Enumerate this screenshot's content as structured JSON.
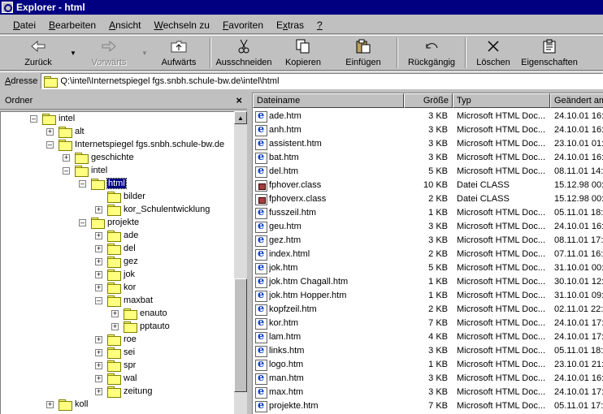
{
  "window": {
    "title": "Explorer - html"
  },
  "menu": [
    {
      "label": "Datei",
      "accel": "D",
      "rest": "atei"
    },
    {
      "label": "Bearbeiten",
      "accel": "B",
      "rest": "earbeiten"
    },
    {
      "label": "Ansicht",
      "accel": "A",
      "rest": "nsicht"
    },
    {
      "label": "Wechseln zu",
      "accel": "W",
      "rest": "echseln zu"
    },
    {
      "label": "Favoriten",
      "accel": "F",
      "rest": "avoriten"
    },
    {
      "label": "Extras",
      "pre": "E",
      "accel": "x",
      "rest": "tras"
    },
    {
      "label": "?",
      "accel": "?",
      "rest": ""
    }
  ],
  "toolbar": {
    "back": "Zurück",
    "forward": "Vorwärts",
    "up": "Aufwärts",
    "cut": "Ausschneiden",
    "copy": "Kopieren",
    "paste": "Einfügen",
    "undo": "Rückgängig",
    "delete": "Löschen",
    "properties": "Eigenschaften"
  },
  "address": {
    "label": "Adresse",
    "value": "Q:\\intel\\Internetspiegel fgs.snbh.schule-bw.de\\intel\\html"
  },
  "folder_pane": {
    "title": "Ordner",
    "close": "×",
    "tree": [
      {
        "label": "intel",
        "level": 0,
        "expander": "-"
      },
      {
        "label": "alt",
        "level": 1,
        "expander": "+"
      },
      {
        "label": "Internetspiegel fgs.snbh.schule-bw.de",
        "level": 1,
        "expander": "-"
      },
      {
        "label": "geschichte",
        "level": 2,
        "expander": "+"
      },
      {
        "label": "intel",
        "level": 2,
        "expander": "-"
      },
      {
        "label": "html",
        "level": 3,
        "expander": "-",
        "selected": true
      },
      {
        "label": "bilder",
        "level": 4,
        "expander": ""
      },
      {
        "label": "kor_Schulentwicklung",
        "level": 4,
        "expander": "+"
      },
      {
        "label": "projekte",
        "level": 3,
        "expander": "-"
      },
      {
        "label": "ade",
        "level": 4,
        "expander": "+"
      },
      {
        "label": "del",
        "level": 4,
        "expander": "+"
      },
      {
        "label": "gez",
        "level": 4,
        "expander": "+"
      },
      {
        "label": "jok",
        "level": 4,
        "expander": "+"
      },
      {
        "label": "kor",
        "level": 4,
        "expander": "+"
      },
      {
        "label": "maxbat",
        "level": 4,
        "expander": "-"
      },
      {
        "label": "enauto",
        "level": 5,
        "expander": "+"
      },
      {
        "label": "pptauto",
        "level": 5,
        "expander": "+"
      },
      {
        "label": "roe",
        "level": 4,
        "expander": "+"
      },
      {
        "label": "sei",
        "level": 4,
        "expander": "+"
      },
      {
        "label": "spr",
        "level": 4,
        "expander": "+"
      },
      {
        "label": "wal",
        "level": 4,
        "expander": "+"
      },
      {
        "label": "zeitung",
        "level": 4,
        "expander": "+"
      },
      {
        "label": "koll",
        "level": 1,
        "expander": "+"
      }
    ]
  },
  "file_list": {
    "columns": [
      "Dateiname",
      "Größe",
      "Typ",
      "Geändert am"
    ],
    "files": [
      {
        "name": "ade.htm",
        "size": "3 KB",
        "type": "Microsoft HTML Doc...",
        "date": "24.10.01 16:",
        "icon": "html"
      },
      {
        "name": "anh.htm",
        "size": "3 KB",
        "type": "Microsoft HTML Doc...",
        "date": "24.10.01 16:",
        "icon": "html"
      },
      {
        "name": "assistent.htm",
        "size": "3 KB",
        "type": "Microsoft HTML Doc...",
        "date": "23.10.01 01:",
        "icon": "html"
      },
      {
        "name": "bat.htm",
        "size": "3 KB",
        "type": "Microsoft HTML Doc...",
        "date": "24.10.01 16:",
        "icon": "html"
      },
      {
        "name": "del.htm",
        "size": "5 KB",
        "type": "Microsoft HTML Doc...",
        "date": "08.11.01 14:",
        "icon": "html"
      },
      {
        "name": "fphover.class",
        "size": "10 KB",
        "type": "Datei CLASS",
        "date": "15.12.98 00:",
        "icon": "class"
      },
      {
        "name": "fphoverx.class",
        "size": "2 KB",
        "type": "Datei CLASS",
        "date": "15.12.98 00:",
        "icon": "class"
      },
      {
        "name": "fusszeil.htm",
        "size": "1 KB",
        "type": "Microsoft HTML Doc...",
        "date": "05.11.01 18:",
        "icon": "html"
      },
      {
        "name": "geu.htm",
        "size": "3 KB",
        "type": "Microsoft HTML Doc...",
        "date": "24.10.01 16:",
        "icon": "html"
      },
      {
        "name": "gez.htm",
        "size": "3 KB",
        "type": "Microsoft HTML Doc...",
        "date": "08.11.01 17:",
        "icon": "html"
      },
      {
        "name": "index.html",
        "size": "2 KB",
        "type": "Microsoft HTML Doc...",
        "date": "07.11.01 16:",
        "icon": "html"
      },
      {
        "name": "jok.htm",
        "size": "5 KB",
        "type": "Microsoft HTML Doc...",
        "date": "31.10.01 00:",
        "icon": "html"
      },
      {
        "name": "jok.htm Chagall.htm",
        "size": "1 KB",
        "type": "Microsoft HTML Doc...",
        "date": "30.10.01 12:",
        "icon": "html"
      },
      {
        "name": "jok.htm Hopper.htm",
        "size": "1 KB",
        "type": "Microsoft HTML Doc...",
        "date": "31.10.01 09:",
        "icon": "html"
      },
      {
        "name": "kopfzeil.htm",
        "size": "2 KB",
        "type": "Microsoft HTML Doc...",
        "date": "02.11.01 22:",
        "icon": "html"
      },
      {
        "name": "kor.htm",
        "size": "7 KB",
        "type": "Microsoft HTML Doc...",
        "date": "24.10.01 17:",
        "icon": "html"
      },
      {
        "name": "lam.htm",
        "size": "4 KB",
        "type": "Microsoft HTML Doc...",
        "date": "24.10.01 17:",
        "icon": "html"
      },
      {
        "name": "links.htm",
        "size": "3 KB",
        "type": "Microsoft HTML Doc...",
        "date": "05.11.01 18:",
        "icon": "html"
      },
      {
        "name": "logo.htm",
        "size": "1 KB",
        "type": "Microsoft HTML Doc...",
        "date": "23.10.01 21:",
        "icon": "html"
      },
      {
        "name": "man.htm",
        "size": "3 KB",
        "type": "Microsoft HTML Doc...",
        "date": "24.10.01 16:",
        "icon": "html"
      },
      {
        "name": "max.htm",
        "size": "3 KB",
        "type": "Microsoft HTML Doc...",
        "date": "24.10.01 17:",
        "icon": "html"
      },
      {
        "name": "projekte.htm",
        "size": "7 KB",
        "type": "Microsoft HTML Doc...",
        "date": "05.11.01 17:",
        "icon": "html"
      }
    ]
  }
}
